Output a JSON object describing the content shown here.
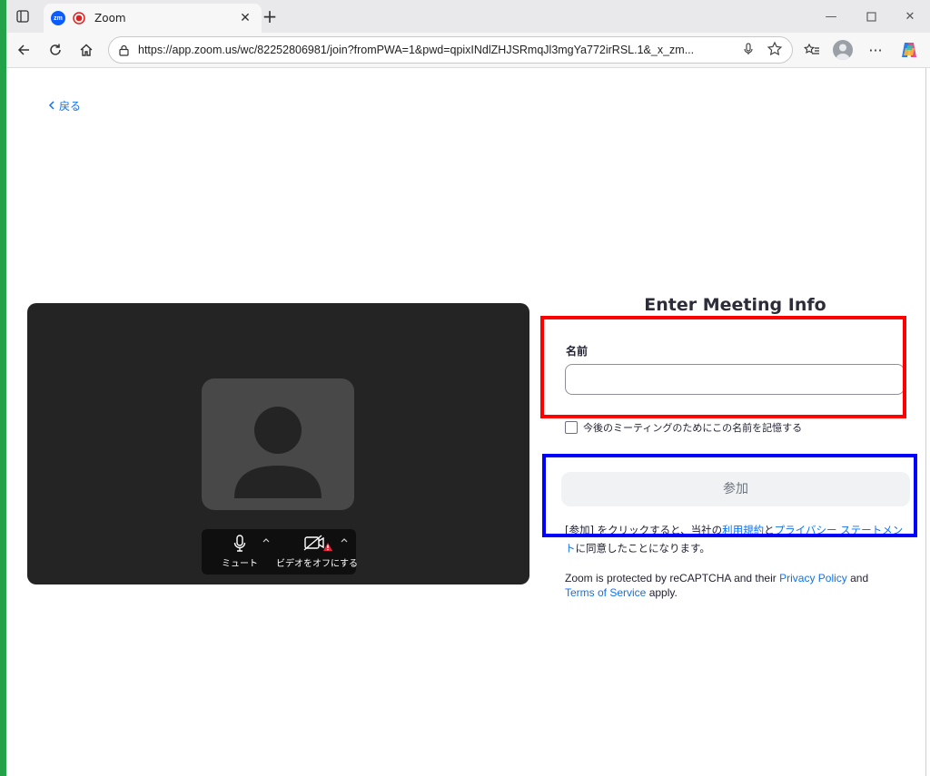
{
  "browser": {
    "tab": {
      "title": "Zoom",
      "favicon_text": "zm"
    },
    "address_bar": {
      "url": "https://app.zoom.us/wc/82252806981/join?fromPWA=1&pwd=qpixINdlZHJSRmqJl3mgYa772irRSL.1&_x_zm..."
    }
  },
  "page": {
    "back_label": "戻る",
    "preview": {
      "mute_label": "ミュート",
      "video_label": "ビデオをオフにする"
    },
    "form": {
      "title": "Enter Meeting Info",
      "name_label": "名前",
      "name_value": "",
      "remember_label": "今後のミーティングのためにこの名前を記憶する",
      "join_label": "参加",
      "terms_prefix": "[参加] をクリックすると、当社の",
      "terms_link1": "利用規約",
      "terms_mid": "と",
      "terms_link2": "プライバシー ステートメント",
      "terms_suffix": "に同意したことになります。",
      "captcha_prefix": "Zoom is protected by reCAPTCHA and their ",
      "captcha_link1": "Privacy Policy",
      "captcha_mid": " and ",
      "captcha_link2": "Terms of Service",
      "captcha_suffix": " apply."
    }
  },
  "colors": {
    "zoom_blue": "#0e72ed",
    "preview_bg": "#242424",
    "annotation_red": "#ff0000",
    "annotation_blue": "#0000ff"
  }
}
